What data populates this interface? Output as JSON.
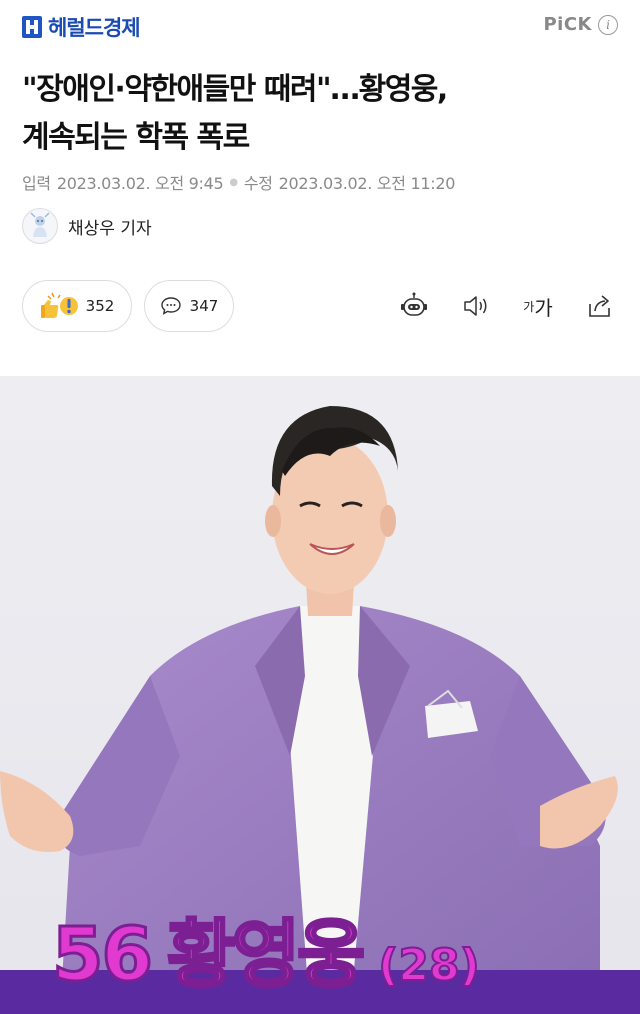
{
  "header": {
    "publisher": "헤럴드경제",
    "pick_label": "PiCK",
    "info_glyph": "i"
  },
  "article": {
    "title_line1": "\"장애인·약한애들만 때려\"…황영웅,",
    "title_line2": "계속되는 학폭 폭로",
    "published_label": "입력",
    "published_at": "2023.03.02. 오전 9:45",
    "updated_label": "수정",
    "updated_at": "2023.03.02. 오전 11:20",
    "reporter": "채상우 기자"
  },
  "actions": {
    "reaction_count": "352",
    "comment_count": "347",
    "font_small": "가",
    "font_large": "가"
  },
  "image": {
    "caption_number": "56",
    "caption_name": "황영웅",
    "caption_age": "(28)"
  },
  "colors": {
    "brand": "#1a4bb3",
    "caption_pink": "#e13ad1",
    "caption_band": "#5a2aa0",
    "jacket": "#9b7fc0"
  }
}
